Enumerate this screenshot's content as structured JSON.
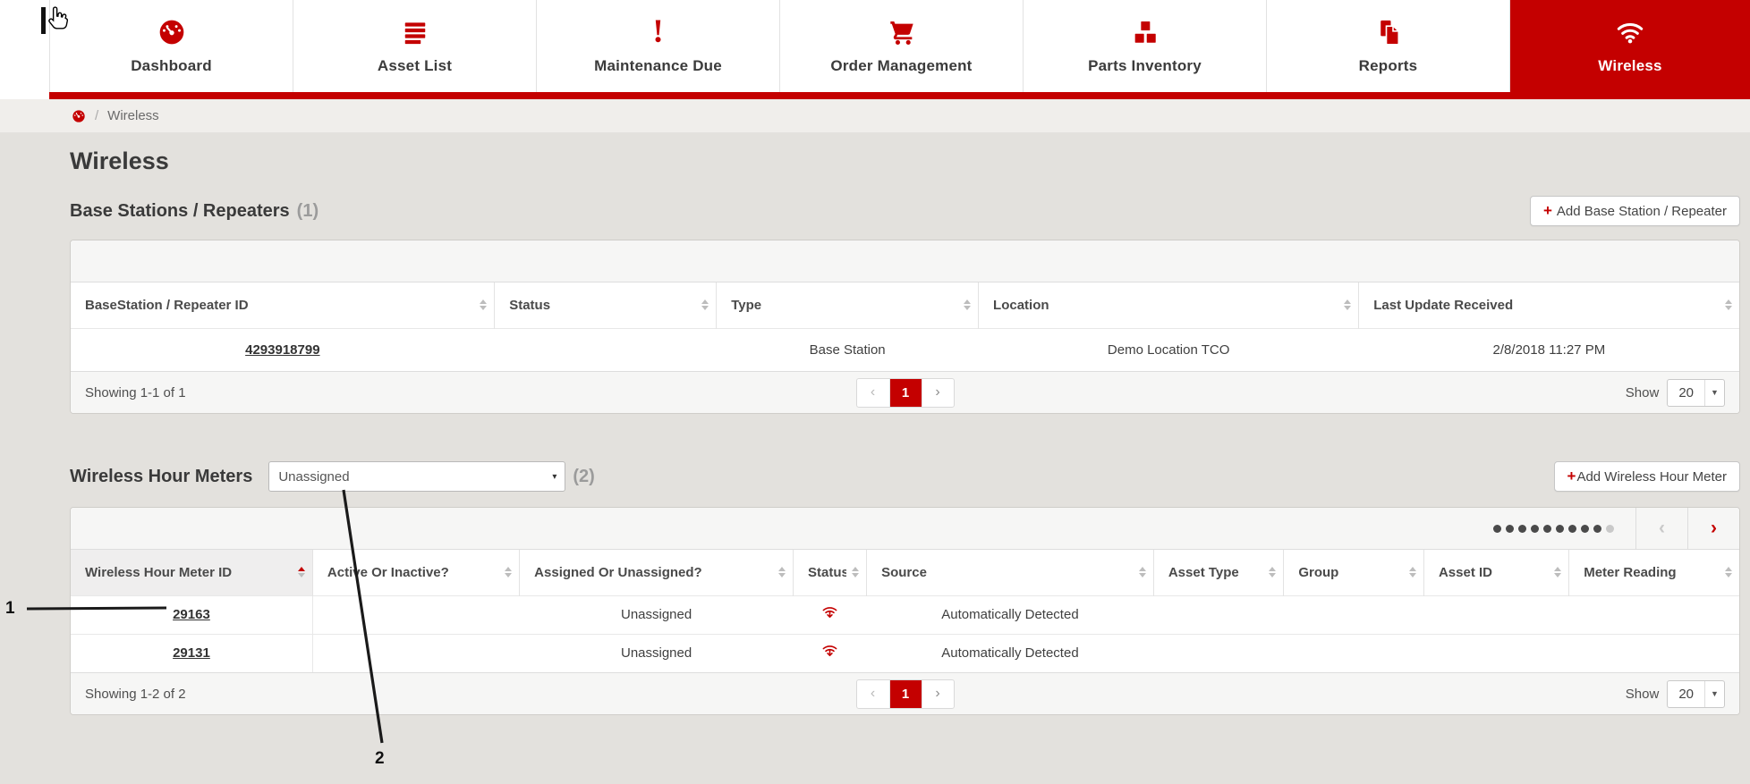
{
  "colors": {
    "accent": "#c40000",
    "page_bg": "#e3e1dd",
    "nav_text": "#3b3b3b"
  },
  "nav": {
    "tabs": [
      {
        "label": "Dashboard",
        "icon": "dashboard-icon",
        "active": false
      },
      {
        "label": "Asset List",
        "icon": "asset-list-icon",
        "active": false
      },
      {
        "label": "Maintenance Due",
        "icon": "exclamation-icon",
        "active": false
      },
      {
        "label": "Order Management",
        "icon": "cart-icon",
        "active": false
      },
      {
        "label": "Parts Inventory",
        "icon": "cubes-icon",
        "active": false
      },
      {
        "label": "Reports",
        "icon": "report-icon",
        "active": false
      },
      {
        "label": "Wireless",
        "icon": "wifi-icon",
        "active": true
      }
    ]
  },
  "breadcrumb": {
    "home_icon": "dashboard-icon",
    "separator": "/",
    "current": "Wireless"
  },
  "page": {
    "title": "Wireless"
  },
  "base_stations": {
    "heading": "Base Stations / Repeaters",
    "count": "(1)",
    "add_button_label": "Add Base Station / Repeater",
    "table": {
      "columns": [
        {
          "label": "BaseStation / Repeater ID"
        },
        {
          "label": "Status"
        },
        {
          "label": "Type"
        },
        {
          "label": "Location"
        },
        {
          "label": "Last Update Received"
        }
      ],
      "rows": [
        {
          "id": "4293918799",
          "status": "",
          "type": "Base Station",
          "location": "Demo Location TCO",
          "last_update": "2/8/2018 11:27 PM"
        }
      ]
    },
    "footer": {
      "showing": "Showing 1-1 of 1",
      "current_page": "1",
      "show_label": "Show",
      "page_size": "20"
    }
  },
  "hour_meters": {
    "heading": "Wireless Hour Meters",
    "filter_selected": "Unassigned",
    "count": "(2)",
    "add_button_label": "Add Wireless Hour Meter",
    "column_pager": {
      "dots_filled": 9,
      "dots_total": 10
    },
    "table": {
      "columns": [
        {
          "label": "Wireless Hour Meter ID",
          "sorted": "asc"
        },
        {
          "label": "Active Or Inactive?"
        },
        {
          "label": "Assigned Or Unassigned?"
        },
        {
          "label": "Status"
        },
        {
          "label": "Source"
        },
        {
          "label": "Asset Type"
        },
        {
          "label": "Group"
        },
        {
          "label": "Asset ID"
        },
        {
          "label": "Meter Reading"
        }
      ],
      "rows": [
        {
          "id": "29163",
          "active_or_inactive": "",
          "assigned_or_unassigned": "Unassigned",
          "status_icon": "wifi-signal-icon",
          "source": "Automatically Detected",
          "asset_type": "",
          "group": "",
          "asset_id": "",
          "meter_reading": ""
        },
        {
          "id": "29131",
          "active_or_inactive": "",
          "assigned_or_unassigned": "Unassigned",
          "status_icon": "wifi-signal-icon",
          "source": "Automatically Detected",
          "asset_type": "",
          "group": "",
          "asset_id": "",
          "meter_reading": ""
        }
      ]
    },
    "footer": {
      "showing": "Showing 1-2 of 2",
      "current_page": "1",
      "show_label": "Show",
      "page_size": "20"
    }
  },
  "annotations": {
    "label_1": "1",
    "label_2": "2"
  }
}
